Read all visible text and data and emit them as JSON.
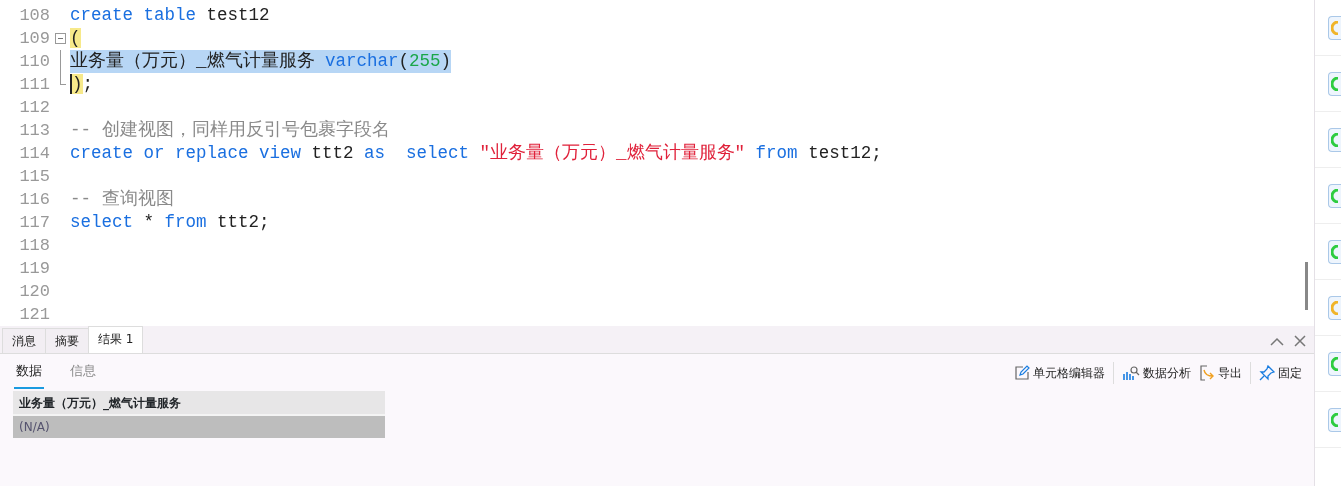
{
  "editor": {
    "lines": [
      {
        "number": "108",
        "selected": false,
        "tokens": [
          {
            "kind": "keyword",
            "text": "create table"
          },
          {
            "kind": "plain",
            "text": " test12"
          }
        ]
      },
      {
        "number": "109",
        "selected": false,
        "fold_toggle": true,
        "tokens": [
          {
            "kind": "bracket_match",
            "text": "("
          }
        ]
      },
      {
        "number": "110",
        "selected": true,
        "fold_guide": true,
        "tokens": [
          {
            "kind": "plain",
            "text": "业务量（万元）_燃气计量服务 "
          },
          {
            "kind": "keyword",
            "text": "varchar"
          },
          {
            "kind": "plain",
            "text": "("
          },
          {
            "kind": "number",
            "text": "255"
          },
          {
            "kind": "plain",
            "text": ")"
          }
        ]
      },
      {
        "number": "111",
        "selected": false,
        "fold_end": true,
        "cursor": true,
        "tokens": [
          {
            "kind": "bracket_match",
            "text": ")"
          },
          {
            "kind": "plain",
            "text": ";"
          }
        ]
      },
      {
        "number": "112",
        "selected": false
      },
      {
        "number": "113",
        "selected": false,
        "tokens": [
          {
            "kind": "comment",
            "text": "-- 创建视图，同样用反引号包裹字段名"
          }
        ]
      },
      {
        "number": "114",
        "selected": false,
        "tokens": [
          {
            "kind": "keyword",
            "text": "create or replace view"
          },
          {
            "kind": "plain",
            "text": " ttt2 "
          },
          {
            "kind": "keyword",
            "text": "as  select"
          },
          {
            "kind": "string",
            "text": " \"业务量（万元）_燃气计量服务\""
          },
          {
            "kind": "keyword",
            "text": " from"
          },
          {
            "kind": "plain",
            "text": " test12;"
          }
        ]
      },
      {
        "number": "115",
        "selected": false
      },
      {
        "number": "116",
        "selected": false,
        "tokens": [
          {
            "kind": "comment",
            "text": "-- 查询视图"
          }
        ]
      },
      {
        "number": "117",
        "selected": false,
        "tokens": [
          {
            "kind": "keyword",
            "text": "select"
          },
          {
            "kind": "plain",
            "text": " * "
          },
          {
            "kind": "keyword",
            "text": "from"
          },
          {
            "kind": "plain",
            "text": " ttt2;"
          }
        ]
      },
      {
        "number": "118",
        "selected": false
      },
      {
        "number": "119",
        "selected": false
      },
      {
        "number": "120",
        "selected": false
      },
      {
        "number": "121",
        "selected": false
      }
    ]
  },
  "result_tabs": [
    {
      "label": "消息",
      "selected": false
    },
    {
      "label": "摘要",
      "selected": false
    },
    {
      "label": "结果 1",
      "selected": true
    }
  ],
  "sub_tabs": [
    {
      "label": "数据",
      "selected": true
    },
    {
      "label": "信息",
      "selected": false
    }
  ],
  "toolbar": [
    {
      "kind": "edit",
      "label": "单元格编辑器"
    },
    {
      "kind": "analysis",
      "label": "数据分析"
    },
    {
      "kind": "export",
      "label": "导出"
    },
    {
      "kind": "pin",
      "label": "固定"
    }
  ],
  "table": {
    "columns": [
      "业务量（万元）_燃气计量服务"
    ],
    "rows": [
      {
        "selected": true,
        "cells": [
          "(N/A)"
        ]
      }
    ]
  },
  "side_items": [
    {
      "color": "#f0b429"
    },
    {
      "color": "#2ecc40"
    },
    {
      "color": "#2ecc40"
    },
    {
      "color": "#2ecc40"
    },
    {
      "color": "#2ecc40"
    },
    {
      "color": "#f0b429"
    },
    {
      "color": "#2ecc40"
    },
    {
      "color": "#2ecc40"
    }
  ]
}
